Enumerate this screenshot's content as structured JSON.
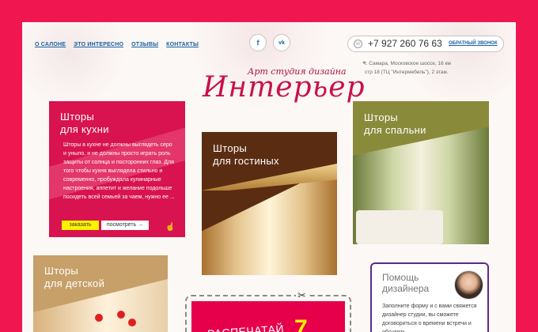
{
  "nav": {
    "items": [
      "О САЛОНЕ",
      "ЭТО ИНТЕРЕСНО",
      "ОТЗЫВЫ",
      "КОНТАКТЫ"
    ]
  },
  "social": {
    "facebook": "f",
    "vk": "vk"
  },
  "contact": {
    "phone": "+7 927 260 76 63",
    "callback": "ОБРАТНЫЙ ЗВОНОК",
    "address_line1": "г. Самара, Московское шоссе, 16 км",
    "address_line2": "стр 18 (ТЦ \"Интермебель\"), 2 этаж."
  },
  "logo": {
    "subtitle": "Арт студия дизайна",
    "title": "Интерьер"
  },
  "cards": {
    "kitchen": {
      "title_line1": "Шторы",
      "title_line2": "для кухни",
      "description": "Шторы в кухне не должны выглядеть серо и уныло, и не должны просто играть роль защиты от солнца и посторонних глаз. Для того чтобы кухня выглядела стильно и современно, пробуждала кулинарные настроения, аппетит и желание подольше посидеть всей семьей за чаем, нужно ее ...",
      "order_button": "заказать",
      "view_button": "посмотреть →"
    },
    "living": {
      "title_line1": "Шторы",
      "title_line2": "для гостиных"
    },
    "bedroom": {
      "title_line1": "Шторы",
      "title_line2": "для спальни"
    },
    "kids": {
      "title_line1": "Шторы",
      "title_line2": "для детской"
    }
  },
  "promo": {
    "text": "РАСПЕЧАТАЙ",
    "number": "7"
  },
  "help": {
    "title_line1": "Помощь",
    "title_line2": "дизайнера",
    "text": "Заполните форму и с вами свяжется дизайнер студии, вы сможете договориться о времени встречи и обсудить"
  },
  "colors": {
    "frame": "#f0164f",
    "accent": "#d8134f",
    "link": "#1b5fa0",
    "order_button": "#fff200"
  }
}
